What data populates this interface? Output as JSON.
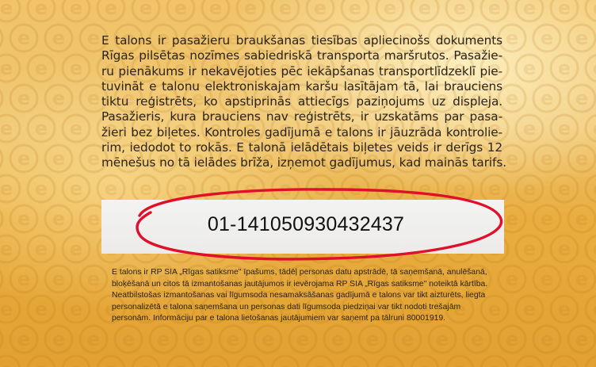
{
  "ticket": {
    "main_lines": [
      "E talons ir pasažieru braukšanas tiesības apliecinošs dokuments",
      "Rīgas pilsētas nozīmes sabiedriskā transporta maršrutos. Pasažie-",
      "ru pienākums ir nekavējoties pēc iekāpšanas transportlīdzeklī pie-",
      "tuvināt e talonu elektroniskajam karšu lasītājam tā, lai brauciens",
      "tiktu reģistrēts, ko apstiprinās attiecīgs paziņojums uz displeja.",
      "Pasažieris, kura brauciens nav reģistrēts, ir uzskatāms par pasa-",
      "žieri bez biļetes. Kontroles gadījumā e talons ir jāuzrāda kontrolie-",
      "rim, iedodot to rokās. E talonā ielādētais biļetes veids ir derīgs 12",
      "mēnešus no tā ielādes brīža, izņemot gadījumus, kad mainās tarifs."
    ],
    "serial_number": "01-141050930432437",
    "fine_lines": [
      "E talons ir RP SIA „Rīgas satiksme\" īpašums, tādēļ personas datu apstrādē, tā saņemšanā, anulēšanā,",
      "bloķēšanā un citos tā izmantošanas jautājumos ir ievērojama RP SIA „Rīgas satiksme\" noteiktā kārtība.",
      "Neatbilstošas izmantošanas vai līgumsoda nesamaksāšanas gadījumā e talons var tikt aizturēts, liegta",
      "personalizētā e talona saņemšana un personas dati līgumsoda piedziņai var tikt nodoti trešajām",
      "personām. Informāciju par e talona lietošanas jautājumiem var saņemt pa tālruni 80001919."
    ],
    "pattern_glyph": "e"
  },
  "colors": {
    "ticket_light": "#f1c46a",
    "ticket_dark": "#e2a032",
    "number_box": "#efeeed",
    "highlight_circle": "#e0102a",
    "text": "#2b2419"
  },
  "icons": {
    "pattern": "e-circle-pattern",
    "annotation": "red-ellipse-highlight"
  }
}
